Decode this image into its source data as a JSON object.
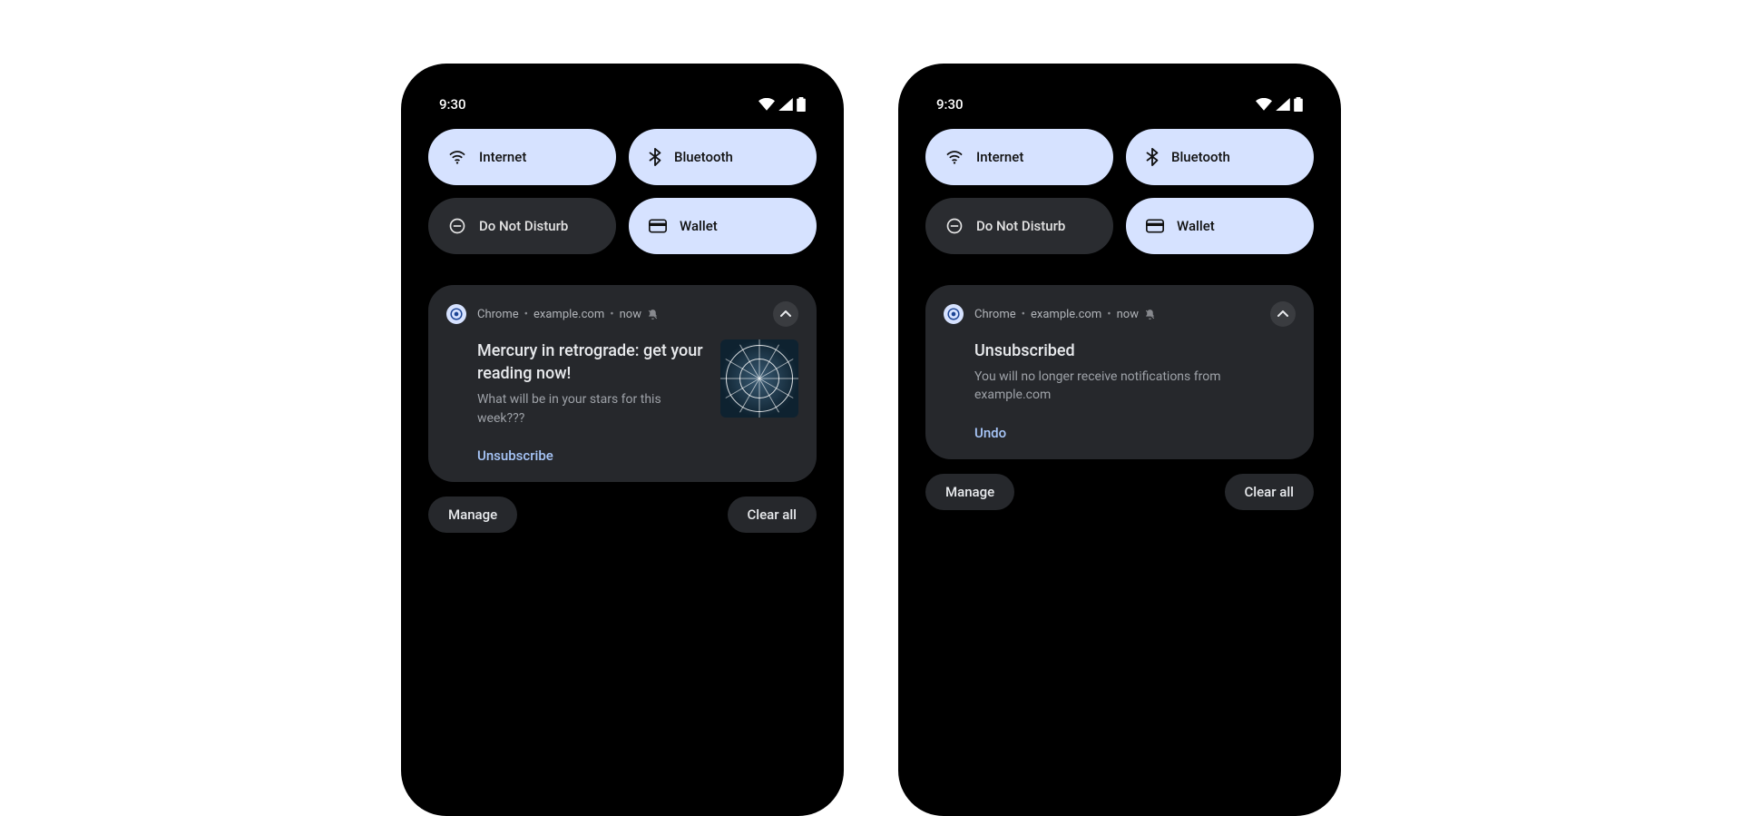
{
  "phones": [
    {
      "status": {
        "time": "9:30"
      },
      "qs": [
        {
          "label": "Internet",
          "icon": "wifi",
          "active": true
        },
        {
          "label": "Bluetooth",
          "icon": "bluetooth",
          "active": true
        },
        {
          "label": "Do Not Disturb",
          "icon": "dnd",
          "active": false
        },
        {
          "label": "Wallet",
          "icon": "wallet",
          "active": true
        }
      ],
      "notif": {
        "app": "Chrome",
        "site": "example.com",
        "when": "now",
        "title": "Mercury in retrograde: get your reading now!",
        "subtitle": "What will be in your stars for this week???",
        "action": "Unsubscribe",
        "has_thumb": true
      },
      "footer": {
        "manage": "Manage",
        "clear": "Clear all"
      }
    },
    {
      "status": {
        "time": "9:30"
      },
      "qs": [
        {
          "label": "Internet",
          "icon": "wifi",
          "active": true
        },
        {
          "label": "Bluetooth",
          "icon": "bluetooth",
          "active": true
        },
        {
          "label": "Do Not Disturb",
          "icon": "dnd",
          "active": false
        },
        {
          "label": "Wallet",
          "icon": "wallet",
          "active": true
        }
      ],
      "notif": {
        "app": "Chrome",
        "site": "example.com",
        "when": "now",
        "title": "Unsubscribed",
        "subtitle": "You will no longer receive notifications from example.com",
        "action": "Undo",
        "has_thumb": false
      },
      "footer": {
        "manage": "Manage",
        "clear": "Clear all"
      }
    }
  ]
}
